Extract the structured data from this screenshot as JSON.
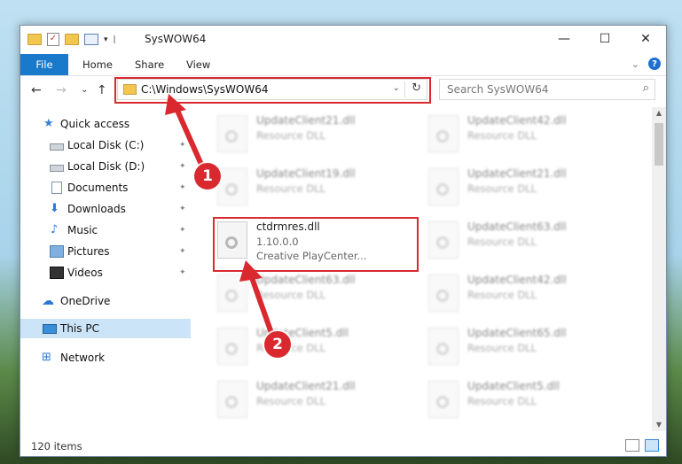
{
  "window": {
    "title": "SysWOW64",
    "controls": {
      "minimize": "—",
      "maximize": "☐",
      "close": "✕"
    }
  },
  "ribbon": {
    "tabs": [
      "File",
      "Home",
      "Share",
      "View"
    ],
    "help": "?"
  },
  "address": {
    "path": "C:\\Windows\\SysWOW64",
    "search_placeholder": "Search SysWOW64"
  },
  "sidebar": {
    "items": [
      {
        "label": "Quick access",
        "icon": "star-icon"
      },
      {
        "label": "Local Disk (C:)",
        "icon": "disk-icon"
      },
      {
        "label": "Local Disk (D:)",
        "icon": "disk-icon"
      },
      {
        "label": "Documents",
        "icon": "documents-icon"
      },
      {
        "label": "Downloads",
        "icon": "download-icon"
      },
      {
        "label": "Music",
        "icon": "music-icon"
      },
      {
        "label": "Pictures",
        "icon": "pictures-icon"
      },
      {
        "label": "Videos",
        "icon": "videos-icon"
      },
      {
        "label": "OneDrive",
        "icon": "cloud-icon"
      },
      {
        "label": "This PC",
        "icon": "computer-icon"
      },
      {
        "label": "Network",
        "icon": "network-icon"
      }
    ]
  },
  "files": {
    "left": [
      {
        "name": "UpdateClient21.dll",
        "type": "Resource DLL"
      },
      {
        "name": "UpdateClient19.dll",
        "type": "Resource DLL"
      },
      {
        "name": "ctdrmres.dll",
        "type": "1.10.0.0",
        "version": "Creative PlayCenter..."
      },
      {
        "name": "UpdateClient63.dll",
        "type": "Resource DLL"
      },
      {
        "name": "UpdateClient5.dll",
        "type": "Resource DLL"
      },
      {
        "name": "UpdateClient21.dll",
        "type": "Resource DLL"
      }
    ],
    "right": [
      {
        "name": "UpdateClient42.dll",
        "type": "Resource DLL"
      },
      {
        "name": "UpdateClient21.dll",
        "type": "Resource DLL"
      },
      {
        "name": "UpdateClient63.dll",
        "type": "Resource DLL"
      },
      {
        "name": "UpdateClient42.dll",
        "type": "Resource DLL"
      },
      {
        "name": "UpdateClient65.dll",
        "type": "Resource DLL"
      },
      {
        "name": "UpdateClient5.dll",
        "type": "Resource DLL"
      }
    ]
  },
  "status": {
    "item_count": "120 items"
  },
  "callouts": {
    "one": "1",
    "two": "2"
  },
  "colors": {
    "accent": "#1979ca",
    "highlight": "#d9292f",
    "selection": "#cce4f7"
  }
}
